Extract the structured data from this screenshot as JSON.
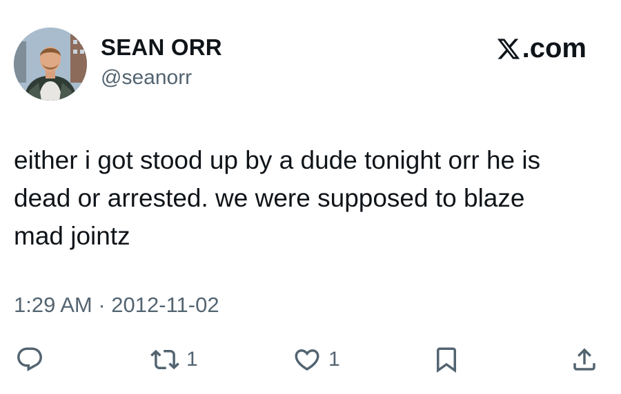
{
  "author": {
    "display_name": "SEAN ORR",
    "handle": "@seanorr",
    "avatar_icon": "profile-photo"
  },
  "brand": {
    "label": ".com",
    "icon": "x-logo-icon"
  },
  "tweet": {
    "text": "either i got stood up by a dude tonight orr he is\ndead or arrested. we were supposed to blaze\nmad jointz",
    "timestamp": "1:29 AM · 2012-11-02"
  },
  "actions": {
    "reply": {
      "icon": "reply-icon"
    },
    "retweet": {
      "icon": "retweet-icon",
      "count": "1"
    },
    "like": {
      "icon": "heart-icon",
      "count": "1"
    },
    "bookmark": {
      "icon": "bookmark-icon"
    },
    "share": {
      "icon": "share-icon"
    }
  },
  "colors": {
    "text_primary": "#0f1419",
    "text_secondary": "#536471",
    "background": "#ffffff"
  }
}
